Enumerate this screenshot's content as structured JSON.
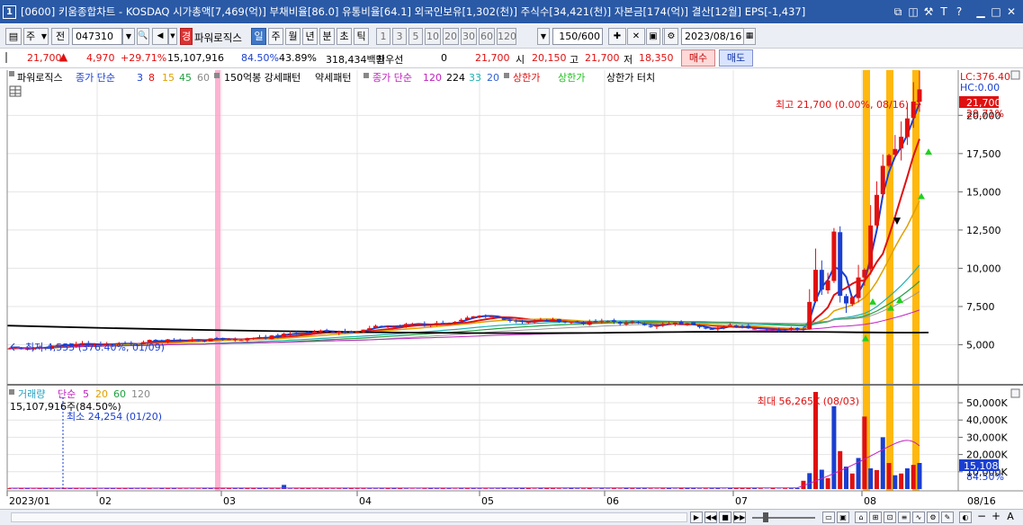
{
  "window": {
    "number": "1",
    "title": "[0600] 키움종합차트 - KOSDAQ 시가총액[7,469(억)] 부채비율[86.0] 유통비율[64.1] 외국인보유[1,302(천)] 주식수[34,421(천)] 자본금[174(억)] 결산[12월] EPS[-1,437]"
  },
  "toolbar": {
    "period_select": "주",
    "prev_label": "전",
    "code_value": "047310",
    "sound_label": "◀",
    "power_badge": "경",
    "stock_name": "파워로직스",
    "period_buttons": [
      "일",
      "주",
      "월",
      "년",
      "분",
      "초",
      "틱"
    ],
    "selected_period": "일",
    "interval_buttons": [
      "1",
      "3",
      "5",
      "10",
      "20",
      "30",
      "60",
      "120"
    ],
    "count_value": "150",
    "count_total": "/600",
    "date_value": "2023/08/16"
  },
  "quote": {
    "price": "21,700",
    "arrow": "▲",
    "change": "4,970",
    "change_pct": "+29.71%",
    "volume": "15,107,916",
    "vol_ratio": "84.50%",
    "turnover_pct": "43.89%",
    "amount": "318,434백만",
    "pref_label": "최우선",
    "pref_value": "0",
    "ask": "21,700",
    "open_label": "시",
    "open": "20,150",
    "high_label": "고",
    "high": "21,700",
    "low_label": "저",
    "low": "18,350",
    "buy_button": "매수",
    "sell_button": "매도"
  },
  "legend_price": {
    "name": "파워로직스",
    "ma_label": "종가 단순",
    "ma_periods": [
      "3",
      "8",
      "15",
      "45",
      "60"
    ],
    "pattern1": "150억봉 강세패턴",
    "pattern2": "약세패턴",
    "ma2_label": "종가 단순",
    "ma2_periods": [
      "120",
      "224",
      "33",
      "20"
    ],
    "limit1": "상한가",
    "limit2": "상한가",
    "limit3": "상한가 터치"
  },
  "legend_volume": {
    "name": "거래량",
    "ma_label": "단순",
    "ma_periods": [
      "5",
      "20",
      "60",
      "120"
    ],
    "today_volume": "15,107,916주(84.50%)",
    "min_label": "최소 24,254 (01/20)",
    "max_label": "최대 56,265K (08/03)"
  },
  "annotations": {
    "high_label": "최고 21,700 (0.00%, 08/16)",
    "low_label": "최저 4,555 (376.40%, 01/09)",
    "lc": "LC:376.40",
    "hc": "HC:0.00",
    "last_price_tag": "21,700",
    "last_pct_tag": "29.71%",
    "last_vol_tag": "15,108K",
    "last_volpct_tag": "84.50%"
  },
  "colors": {
    "up": "#e01010",
    "down": "#1a3fd0",
    "highlight_band": "#ffb400",
    "pink_band": "#ff9fc8",
    "title_bg": "#2a59a6"
  },
  "chart_data": {
    "type": "candlestick",
    "price_axis_ticks": [
      "5,000",
      "7,500",
      "10,000",
      "12,500",
      "15,000",
      "17,500",
      "20,000"
    ],
    "price_axis_values": [
      5000,
      7500,
      10000,
      12500,
      15000,
      17500,
      20000
    ],
    "price_range": [
      2500,
      21900
    ],
    "volume_axis_ticks": [
      "10,000K",
      "20,000K",
      "30,000K",
      "40,000K",
      "50,000K"
    ],
    "volume_axis_values": [
      10000,
      20000,
      30000,
      40000,
      50000
    ],
    "volume_range": [
      0,
      56265
    ],
    "x_axis_labels": [
      "2023/01",
      "02",
      "03",
      "04",
      "05",
      "06",
      "07",
      "08"
    ],
    "x_axis_end": "08/16",
    "last_close": 21700,
    "period_high": 21700,
    "period_low": 4555
  },
  "statusbar": {
    "play_buttons": [
      "▶",
      "◀◀",
      "■",
      "▶▶"
    ],
    "right_icons": [
      "−",
      "+",
      "A"
    ]
  }
}
